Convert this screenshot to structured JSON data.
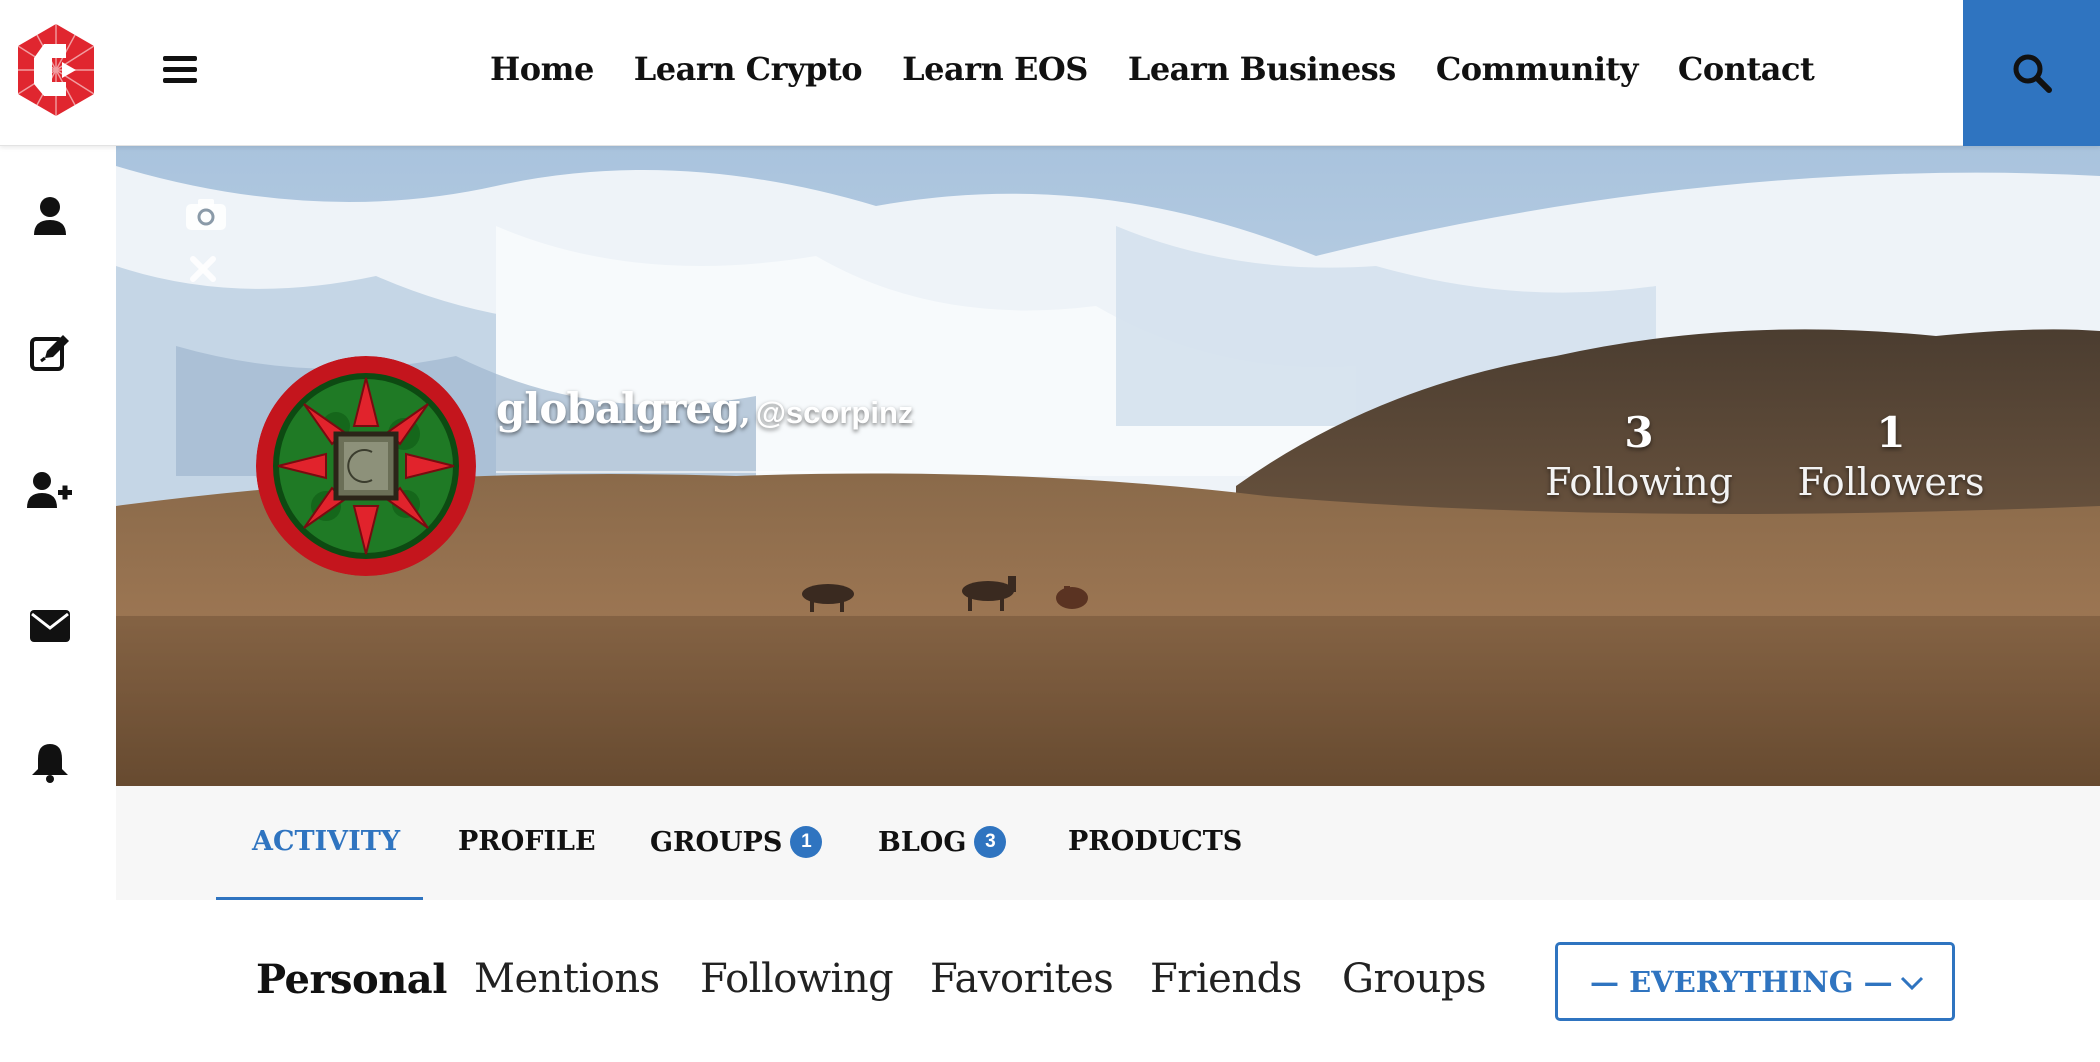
{
  "header": {
    "nav": [
      "Home",
      "Learn Crypto",
      "Learn EOS",
      "Learn Business",
      "Community",
      "Contact"
    ],
    "accent_color": "#2f74c0",
    "logo_color": "#e0262f",
    "search_icon": "search-icon",
    "menu_icon": "hamburger-menu-icon"
  },
  "sidebar": {
    "icons": [
      "user-icon",
      "edit-icon",
      "add-user-icon",
      "envelope-icon",
      "bell-icon"
    ]
  },
  "profile": {
    "display_name": "globalgreg",
    "separator": ",",
    "handle": "@scorpinz",
    "following_count": "3",
    "following_label": "Following",
    "followers_count": "1",
    "followers_label": "Followers",
    "cover_tools": [
      "camera-icon",
      "close-icon"
    ]
  },
  "tabs": [
    {
      "label": "ACTIVITY"
    },
    {
      "label": "PROFILE"
    },
    {
      "label": "GROUPS",
      "count": "1"
    },
    {
      "label": "BLOG",
      "count": "3"
    },
    {
      "label": "PRODUCTS"
    }
  ],
  "subnav": [
    "Personal",
    "Mentions",
    "Following",
    "Favorites",
    "Friends",
    "Groups"
  ],
  "filter": {
    "selected": "— EVERYTHING —"
  }
}
